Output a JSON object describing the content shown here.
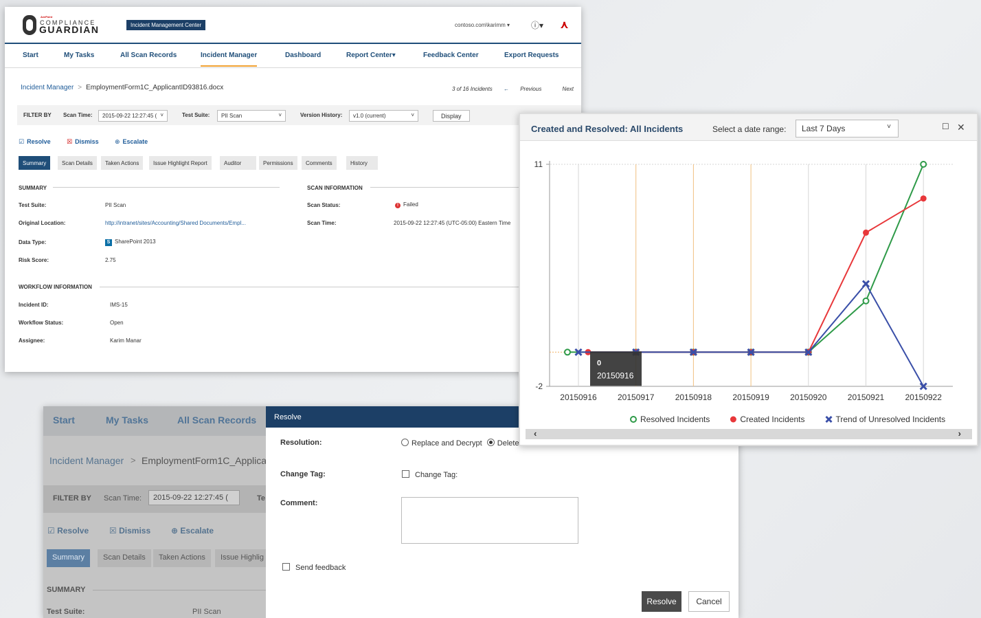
{
  "main": {
    "logo": {
      "brand": "AvePoint",
      "top": "COMPLIANCE",
      "bottom": "GUARDIAN"
    },
    "app_badge": "Incident Management Center",
    "user": "contoso.com\\karimm",
    "nav": [
      "Start",
      "My Tasks",
      "All Scan Records",
      "Incident Manager",
      "Dashboard",
      "Report Center",
      "Feedback Center",
      "Export Requests"
    ],
    "active_nav": "Incident Manager",
    "breadcrumb": {
      "root": "Incident Manager",
      "separator": ">",
      "current": "EmploymentForm1C_ApplicantID93816.docx"
    },
    "pager": {
      "position": "3 of 16 Incidents",
      "previous": "Previous",
      "next": "Next"
    },
    "filter": {
      "label": "FILTER BY",
      "scan_time_label": "Scan Time:",
      "scan_time_value": "2015-09-22 12:27:45 (",
      "test_suite_label": "Test Suite:",
      "test_suite_value": "PII Scan",
      "version_label": "Version History:",
      "version_value": "v1.0 (current)",
      "display_button": "Display"
    },
    "actions": {
      "resolve": "Resolve",
      "dismiss": "Dismiss",
      "escalate": "Escalate"
    },
    "tabs": [
      "Summary",
      "Scan Details",
      "Taken Actions",
      "Issue Highlight Report",
      "Auditor",
      "Permissions",
      "Comments",
      "History"
    ],
    "summary": {
      "title": "SUMMARY",
      "test_suite_label": "Test Suite:",
      "test_suite": "PII Scan",
      "location_label": "Original Location:",
      "location": "http://intranet/sites/Accounting/Shared Documents/Empl...",
      "data_type_label": "Data Type:",
      "data_type": "SharePoint 2013",
      "risk_label": "Risk Score:",
      "risk": "2.75"
    },
    "scan_info": {
      "title": "SCAN INFORMATION",
      "status_label": "Scan Status:",
      "status": "Failed",
      "time_label": "Scan Time:",
      "time": "2015-09-22 12:27:45 (UTC-05:00) Eastern Time"
    },
    "workflow": {
      "title": "WORKFLOW INFORMATION",
      "id_label": "Incident ID:",
      "id": "IMS-15",
      "status_label": "Workflow Status:",
      "status": "Open",
      "assignee_label": "Assignee:",
      "assignee": "Karim Manar"
    }
  },
  "back": {
    "nav": [
      "Start",
      "My Tasks",
      "All Scan Records"
    ],
    "breadcrumb_root": "Incident Manager",
    "breadcrumb_sep": ">",
    "breadcrumb_current": "EmploymentForm1C_Applican",
    "filter_label": "FILTER BY",
    "scan_time_label": "Scan Time:",
    "scan_time_value": "2015-09-22 12:27:45 (",
    "cut_label": "Te",
    "actions": {
      "resolve": "Resolve",
      "dismiss": "Dismiss",
      "escalate": "Escalate"
    },
    "tabs": [
      "Summary",
      "Scan Details",
      "Taken Actions",
      "Issue Highlig"
    ],
    "summary_title": "SUMMARY",
    "test_suite_label": "Test Suite:",
    "test_suite": "PII Scan"
  },
  "dialog": {
    "title": "Resolve",
    "resolution_label": "Resolution:",
    "option_replace": "Replace and Decrypt",
    "option_delete": "Delete",
    "change_tag_label": "Change Tag:",
    "change_tag_check": "Change Tag:",
    "comment_label": "Comment:",
    "send_feedback": "Send feedback",
    "resolve_button": "Resolve",
    "cancel_button": "Cancel"
  },
  "chart_window": {
    "title": "Created and Resolved: All Incidents",
    "range_label": "Select a date range:",
    "range_value": "Last 7 Days"
  },
  "chart_data": {
    "type": "line",
    "title": "Created and Resolved: All Incidents",
    "categories": [
      "20150916",
      "20150917",
      "20150918",
      "20150919",
      "20150920",
      "20150921",
      "20150922"
    ],
    "ylim": [
      -2,
      11
    ],
    "y_ticks": [
      "11",
      "-2"
    ],
    "series": [
      {
        "name": "Resolved Incidents",
        "color": "#2e9a48",
        "marker": "open-circle",
        "values": [
          0,
          0,
          0,
          0,
          0,
          3,
          11
        ]
      },
      {
        "name": "Created Incidents",
        "color": "#e8373a",
        "marker": "filled-circle",
        "values": [
          0,
          0,
          0,
          0,
          0,
          7,
          9
        ]
      },
      {
        "name": "Trend of Unresolved Incidents",
        "color": "#3a4fa8",
        "marker": "x",
        "values": [
          0,
          0,
          0,
          0,
          0,
          4,
          -2
        ]
      }
    ],
    "tooltip": {
      "value": "0",
      "category": "20150916"
    },
    "legend": "bottom",
    "grid": true
  }
}
